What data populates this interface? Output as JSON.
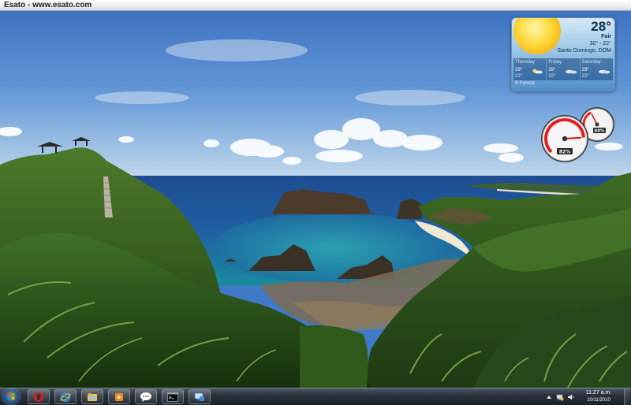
{
  "window": {
    "caption": "Esato - www.esato.com"
  },
  "wallpaper": {
    "description_icon": "landscape-photo"
  },
  "weather": {
    "temperature": "28°",
    "condition": "Fair",
    "high_low": "30° - 22°",
    "location": "Santo Domingo, DOM",
    "forecast": [
      {
        "day": "Thursday",
        "high": "29°",
        "low": "21°",
        "icon": "partly-cloudy-icon"
      },
      {
        "day": "Friday",
        "high": "29°",
        "low": "22°",
        "icon": "cloudy-icon"
      },
      {
        "day": "Saturday",
        "high": "29°",
        "low": "22°",
        "icon": "cloudy-icon"
      }
    ],
    "credit": "© Foreca",
    "colors": {
      "sun": "#ffd93a",
      "panel": "#4f8fc8"
    }
  },
  "cpu_meter": {
    "cpu_percent": 82,
    "cpu_label": "82%",
    "memory_percent": 40,
    "memory_label": "40%",
    "accent": "#e02020"
  },
  "taskbar": {
    "apps": [
      {
        "name": "opera-icon",
        "title": "Opera"
      },
      {
        "name": "internet-explorer-icon",
        "title": "Internet Explorer"
      },
      {
        "name": "file-explorer-icon",
        "title": "Windows Explorer"
      },
      {
        "name": "media-player-icon",
        "title": "Media Player"
      },
      {
        "name": "google-talk-icon",
        "title": "Google Talk"
      },
      {
        "name": "command-prompt-icon",
        "title": "Command Prompt"
      },
      {
        "name": "remote-desktop-icon",
        "title": "Remote Desktop"
      }
    ],
    "clock": {
      "time": "11:27 a.m.",
      "date": "10/11/2010"
    },
    "tray_icons": [
      "show-hidden-icons-icon",
      "network-icon",
      "volume-icon"
    ]
  }
}
